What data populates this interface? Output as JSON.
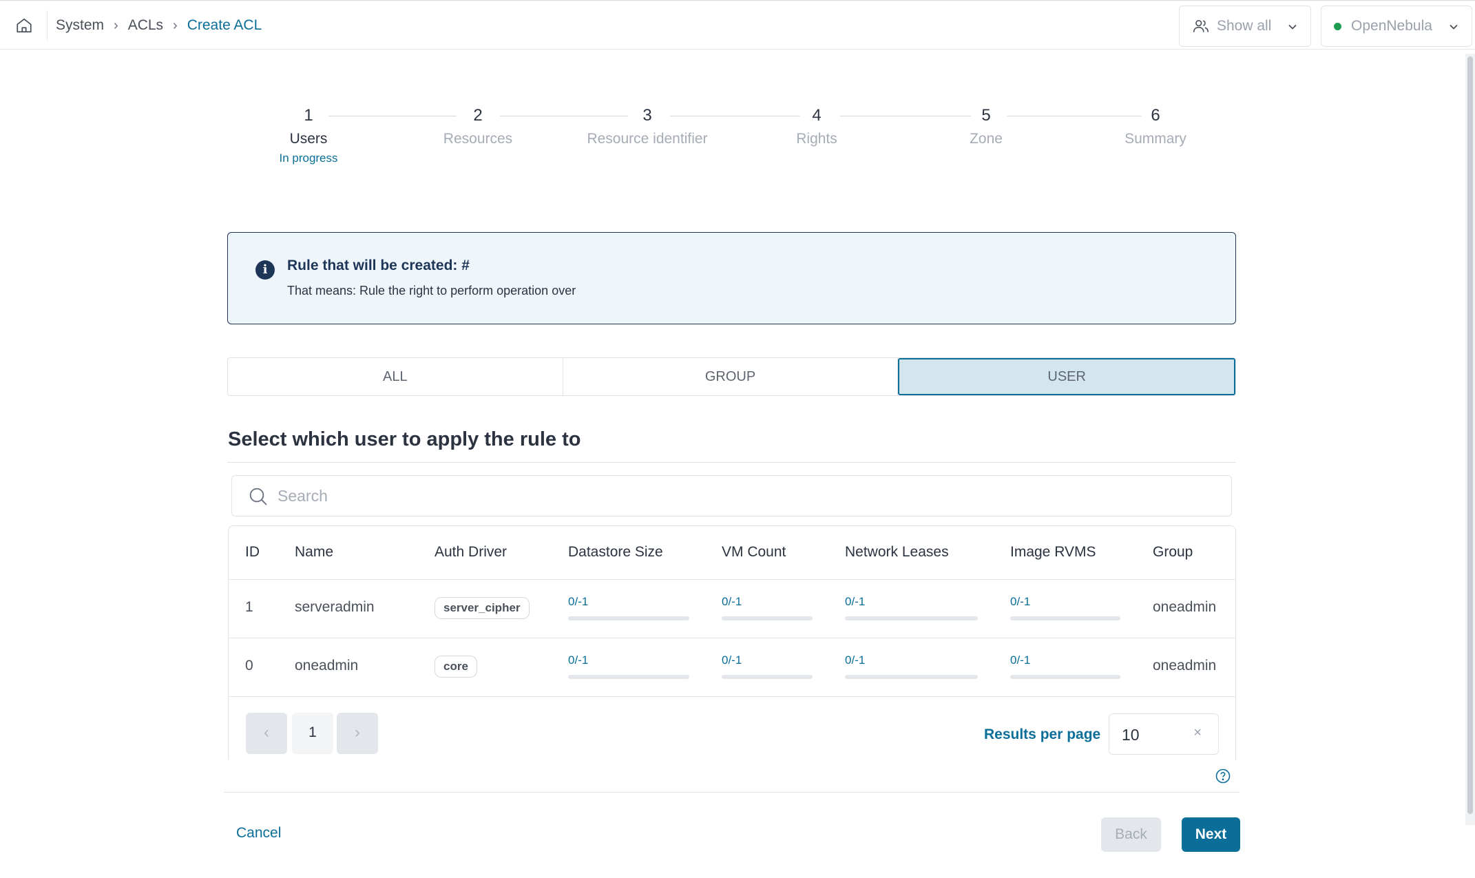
{
  "breadcrumb": [
    "System",
    "ACLs",
    "Create ACL"
  ],
  "header": {
    "show_all": "Show all",
    "zone": "OpenNebula",
    "zone_status_color": "#1e9b4f"
  },
  "stepper": {
    "steps": [
      {
        "num": "1",
        "label": "Users",
        "status": "In progress"
      },
      {
        "num": "2",
        "label": "Resources"
      },
      {
        "num": "3",
        "label": "Resource identifier"
      },
      {
        "num": "4",
        "label": "Rights"
      },
      {
        "num": "5",
        "label": "Zone"
      },
      {
        "num": "6",
        "label": "Summary"
      }
    ],
    "current": 0
  },
  "info": {
    "title": "Rule that will be created: #",
    "text": "That means: Rule the right to perform operation over"
  },
  "tabs": {
    "items": [
      "ALL",
      "GROUP",
      "USER"
    ],
    "selected": 2
  },
  "section_title": "Select which user to apply the rule to",
  "search": {
    "placeholder": "Search",
    "value": ""
  },
  "table": {
    "columns": [
      "ID",
      "Name",
      "Auth Driver",
      "Datastore Size",
      "VM Count",
      "Network Leases",
      "Image RVMS",
      "Group"
    ],
    "rows": [
      {
        "id": "1",
        "name": "serveradmin",
        "auth": "server_cipher",
        "datastore": "0/-1",
        "vm": "0/-1",
        "network": "0/-1",
        "image": "0/-1",
        "group": "oneadmin"
      },
      {
        "id": "0",
        "name": "oneadmin",
        "auth": "core",
        "datastore": "0/-1",
        "vm": "0/-1",
        "network": "0/-1",
        "image": "0/-1",
        "group": "oneadmin"
      }
    ]
  },
  "pagination": {
    "prev": "‹",
    "page": "1",
    "next": "›",
    "results_label": "Results per page",
    "results_value": "10",
    "clear": "×"
  },
  "footer": {
    "cancel": "Cancel",
    "back": "Back",
    "next": "Next"
  },
  "colors": {
    "accent": "#0b6e99",
    "navy": "#1d3557",
    "info_bg": "#eef5fb",
    "tab_selected_bg": "#d3e6ee"
  }
}
